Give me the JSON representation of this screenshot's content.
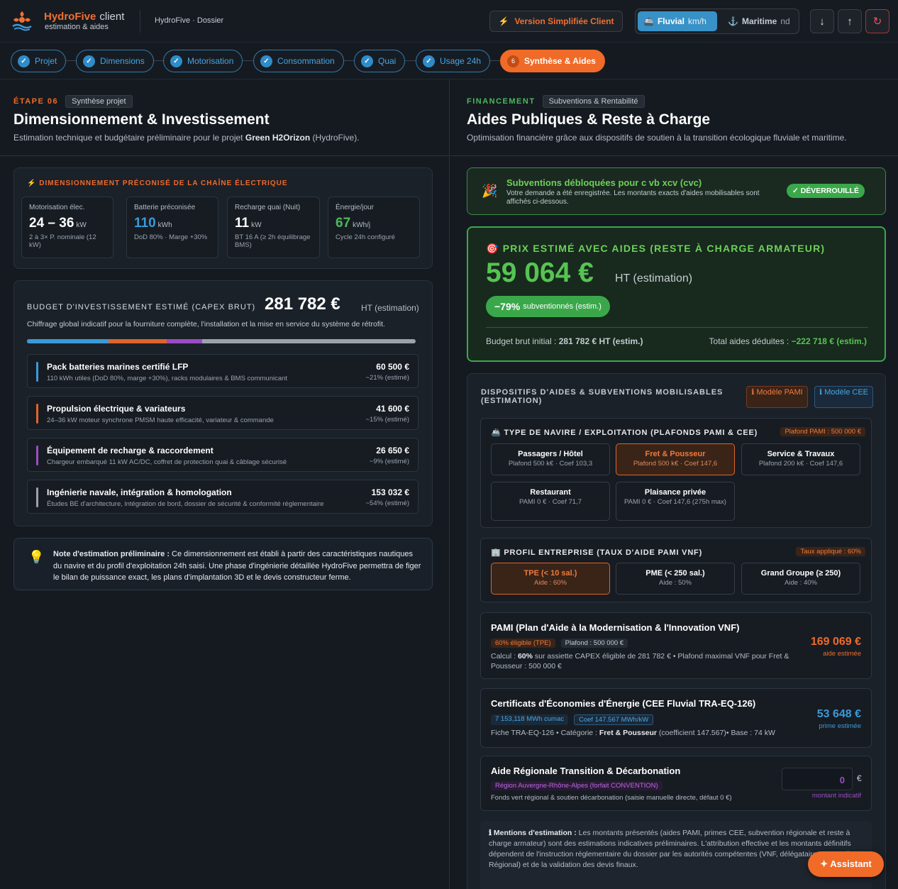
{
  "app": {
    "brand_a": "HydroFive",
    "brand_b": "client",
    "brand_sub": "estimation & aides",
    "breadcrumb": "HydroFive · Dossier",
    "simplified_label": "Version Simplifiée Client",
    "mode_fluvial": "Fluvial",
    "mode_fluvial_unit": "km/h",
    "mode_maritime": "Maritime",
    "mode_maritime_unit": "nd"
  },
  "steps": [
    {
      "label": "Projet",
      "mark": "✓"
    },
    {
      "label": "Dimensions",
      "mark": "✓"
    },
    {
      "label": "Motorisation",
      "mark": "✓"
    },
    {
      "label": "Consommation",
      "mark": "✓"
    },
    {
      "label": "Quai",
      "mark": "✓"
    },
    {
      "label": "Usage 24h",
      "mark": "✓"
    },
    {
      "label": "Synthèse & Aides",
      "mark": "6"
    }
  ],
  "left": {
    "eyebrow": "ÉTAPE 06",
    "tag": "Synthèse projet",
    "title": "Dimensionnement & Investissement",
    "subtitle_a": "Estimation technique et budgétaire préliminaire pour le projet ",
    "subtitle_b": "Green H2Orizon",
    "subtitle_c": " (HydroFive).",
    "sizing_title": "DIMENSIONNEMENT PRÉCONISÉ DE LA CHAÎNE ÉLECTRIQUE",
    "stats": [
      {
        "label": "Motorisation élec.",
        "value": "24 – 36",
        "unit": "kW",
        "sub": "2 à 3× P. nominale (12 kW)",
        "color": "#ffffff"
      },
      {
        "label": "Batterie préconisée",
        "value": "110",
        "unit": "kWh",
        "sub": "DoD 80% · Marge +30%",
        "color": "#3a9ad9"
      },
      {
        "label": "Recharge quai (Nuit)",
        "value": "11",
        "unit": "kW",
        "sub": "BT 16 A (≥ 2h équilibrage BMS)",
        "color": "#ffffff"
      },
      {
        "label": "Énergie/jour",
        "value": "67",
        "unit": "kWh/j",
        "sub": "Cycle 24h configuré",
        "color": "#4cb85a"
      }
    ],
    "budget_label": "BUDGET D'INVESTISSEMENT ESTIMÉ (CAPEX BRUT)",
    "budget_value": "281 782 €",
    "budget_unit": "HT (estimation)",
    "budget_desc": "Chiffrage global indicatif pour la fourniture complète, l'installation et la mise en service du système de rétrofit.",
    "budget_items": [
      {
        "title": "Pack batteries marines certifié LFP",
        "desc": "110 kWh utiles (DoD 80%, marge +30%), racks modulaires & BMS communicant",
        "amount": "60 500 €",
        "pct": "~21% (estimé)",
        "share": 0.21,
        "color": "#3a9ad9"
      },
      {
        "title": "Propulsion électrique & variateurs",
        "desc": "24–36 kW moteur synchrone PMSM haute efficacité, variateur & commande",
        "amount": "41 600 €",
        "pct": "~15% (estimé)",
        "share": 0.15,
        "color": "#e0642a"
      },
      {
        "title": "Équipement de recharge & raccordement",
        "desc": "Chargeur embarqué 11 kW AC/DC, coffret de protection quai & câblage sécurisé",
        "amount": "26 650 €",
        "pct": "~9% (estimé)",
        "share": 0.09,
        "color": "#9b4cc4"
      },
      {
        "title": "Ingénierie navale, intégration & homologation",
        "desc": "Études BE d'architecture, intégration de bord, dossier de sécurité & conformité réglementaire",
        "amount": "153 032 €",
        "pct": "~54% (estimé)",
        "share": 0.54,
        "color": "#9aa3ad"
      }
    ],
    "note_bold": "Note d'estimation préliminaire :",
    "note_text": " Ce dimensionnement est établi à partir des caractéristiques nautiques du navire et du profil d'exploitation 24h saisi. Une phase d'ingénierie détaillée HydroFive permettra de figer le bilan de puissance exact, les plans d'implantation 3D et le devis constructeur ferme."
  },
  "right": {
    "eyebrow": "FINANCEMENT",
    "tag": "Subventions & Rentabilité",
    "title": "Aides Publiques & Reste à Charge",
    "subtitle": "Optimisation financière grâce aux dispositifs de soutien à la transition écologique fluviale et maritime.",
    "unlock_title": "Subventions débloquées pour c vb xcv (cvc)",
    "unlock_desc": "Votre demande a été enregistrée. Les montants exacts d'aides mobilisables sont affichés ci-dessous.",
    "unlock_badge": "✓ DÉVERROUILLÉ",
    "price_label": "PRIX ESTIMÉ AVEC AIDES (RESTE À CHARGE ARMATEUR)",
    "price_value": "59 064 €",
    "price_unit": "HT (estimation)",
    "price_pct": "−79%",
    "price_pct_label": "subventionnés (estim.)",
    "brut_label": "Budget brut initial : ",
    "brut_value": "281 782 € HT (estim.)",
    "aides_label": "Total aides déduites : ",
    "aides_value": "−222 718 € (estim.)",
    "dispo_title": "DISPOSITIFS D'AIDES & SUBVENTIONS MOBILISABLES (ESTIMATION)",
    "btn_pami": "ℹ Modèle PAMI",
    "btn_cee": "ℹ Modèle CEE",
    "type_title": "TYPE DE NAVIRE / EXPLOITATION (PLAFONDS PAMI & CEE)",
    "type_badge": "Plafond PAMI : 500 000 €",
    "types": [
      {
        "title": "Passagers / Hôtel",
        "sub": "Plafond 500 k€ · Coef 103,3"
      },
      {
        "title": "Fret & Pousseur",
        "sub": "Plafond 500 k€ · Coef 147,6"
      },
      {
        "title": "Service & Travaux",
        "sub": "Plafond 200 k€ · Coef 147,6"
      },
      {
        "title": "Restaurant",
        "sub": "PAMI 0 € · Coef 71,7"
      },
      {
        "title": "Plaisance privée",
        "sub": "PAMI 0 € · Coef 147,6 (275h max)"
      }
    ],
    "profil_title": "PROFIL ENTREPRISE (TAUX D'AIDE PAMI VNF)",
    "profil_badge": "Taux appliqué : 60%",
    "profils": [
      {
        "title": "TPE (< 10 sal.)",
        "sub": "Aide : 60%"
      },
      {
        "title": "PME (< 250 sal.)",
        "sub": "Aide : 50%"
      },
      {
        "title": "Grand Groupe (≥ 250)",
        "sub": "Aide : 40%"
      }
    ],
    "pami_title": "PAMI (Plan d'Aide à la Modernisation & l'Innovation VNF)",
    "pami_pill1": "60% éligible (TPE)",
    "pami_pill2": "Plafond : 500 000 €",
    "pami_calc_a": "Calcul : ",
    "pami_calc_b": "60%",
    "pami_calc_c": " sur assiette CAPEX éligible de 281 782 € • Plafond maximal VNF pour Fret & Pousseur : 500 000 €",
    "pami_amount": "169 069 €",
    "pami_amount_label": "aide estimée",
    "cee_title": "Certificats d'Économies d'Énergie (CEE Fluvial TRA-EQ-126)",
    "cee_pill1": "7 153,118 MWh cumac",
    "cee_pill2": "Coef 147.567 MWh/kW",
    "cee_desc_a": "Fiche TRA-EQ-126 • Catégorie : ",
    "cee_desc_b": "Fret & Pousseur",
    "cee_desc_c": " (coefficient 147.567)• Base : 74 kW",
    "cee_amount": "53 648 €",
    "cee_amount_label": "prime estimée",
    "reg_title": "Aide Régionale Transition & Décarbonation",
    "reg_pill": "Région Auvergne-Rhône-Alpes (forfait CONVENTION)",
    "reg_desc": "Fonds vert régional & soutien décarbonation (saisie manuelle directe, défaut 0 €)",
    "reg_value": "0",
    "reg_currency": "€",
    "reg_label": "montant indicatif",
    "mentions_bold": "ℹ Mentions d'estimation :",
    "mentions_text": " Les montants présentés (aides PAMI, primes CEE, subvention régionale et reste à charge armateur) sont des estimations indicatives préliminaires. L'attribution effective et les montants définitifs dépendent de l'instruction réglementaire du dossier par les autorités compétentes (VNF, délégataires, Conseil Régional) et de la validation des devis finaux."
  },
  "assistant_label": "✦ Assistant",
  "colors": {
    "accent": "#f06a28",
    "blue": "#3a9ad9",
    "green": "#4cb85a",
    "purple": "#9b4cc4"
  }
}
